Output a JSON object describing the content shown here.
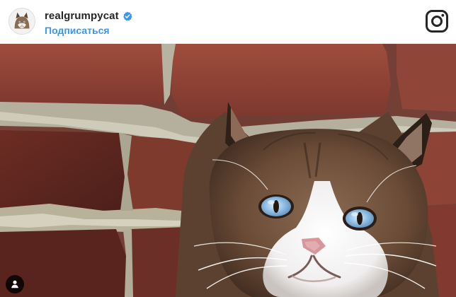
{
  "post": {
    "username": "realgrumpycat",
    "follow_label": "Подписаться"
  },
  "icons": {
    "verified": "verified-badge-icon",
    "logo": "instagram-logo-icon",
    "tag": "user-tag-icon"
  },
  "colors": {
    "follow_link": "#3897f0",
    "verified_badge": "#3897f0",
    "username_text": "#262626"
  }
}
